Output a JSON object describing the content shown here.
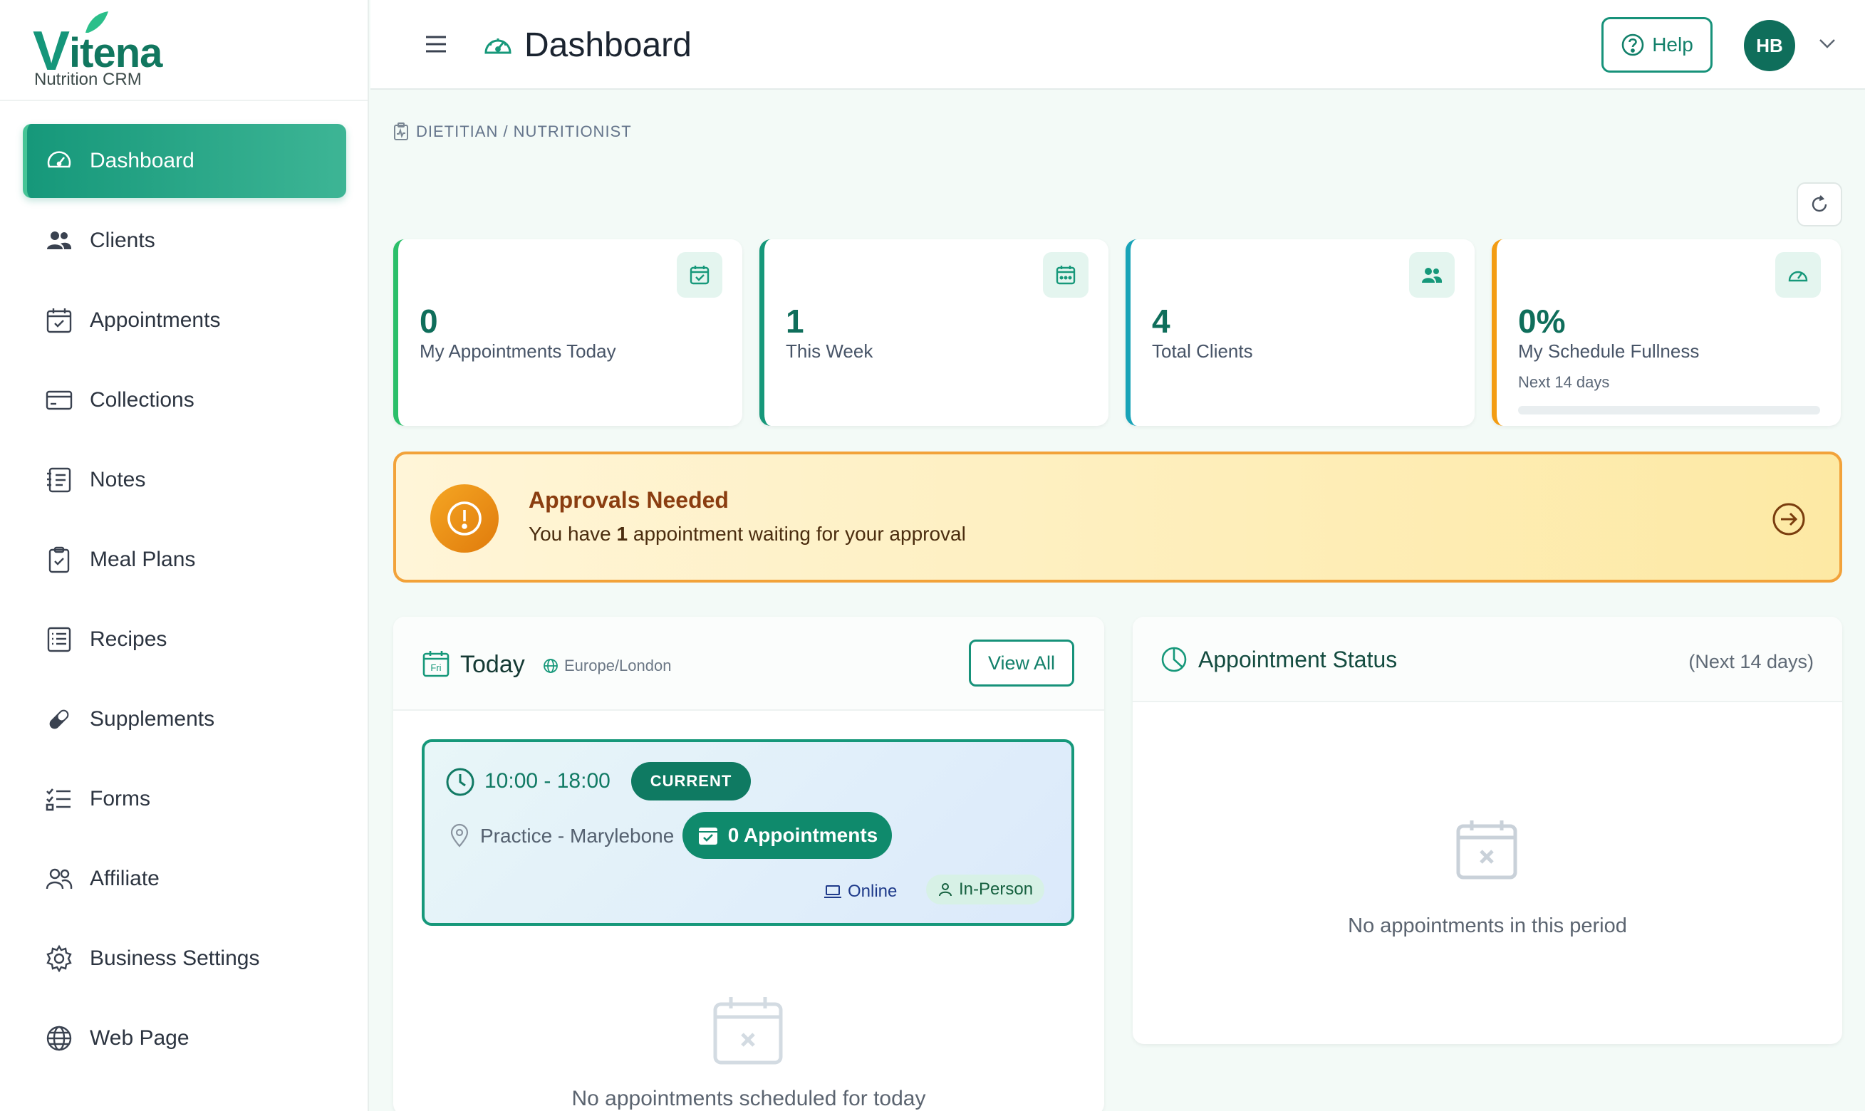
{
  "brand": {
    "name": "itena",
    "initial": "V",
    "subtitle": "Nutrition CRM"
  },
  "sidebar": {
    "items": [
      {
        "label": "Dashboard",
        "icon": "gauge-icon",
        "active": true
      },
      {
        "label": "Clients",
        "icon": "users-icon"
      },
      {
        "label": "Appointments",
        "icon": "calendar-check-icon"
      },
      {
        "label": "Collections",
        "icon": "credit-card-icon"
      },
      {
        "label": "Notes",
        "icon": "notes-icon"
      },
      {
        "label": "Meal Plans",
        "icon": "clipboard-check-icon"
      },
      {
        "label": "Recipes",
        "icon": "recipe-list-icon"
      },
      {
        "label": "Supplements",
        "icon": "capsule-icon"
      },
      {
        "label": "Forms",
        "icon": "checklist-icon"
      },
      {
        "label": "Affiliate",
        "icon": "people-outline-icon"
      },
      {
        "label": "Business Settings",
        "icon": "gear-icon"
      },
      {
        "label": "Web Page",
        "icon": "globe-icon"
      }
    ]
  },
  "header": {
    "title": "Dashboard",
    "help_label": "Help",
    "avatar_initials": "HB"
  },
  "breadcrumb": "DIETITIAN / NUTRITIONIST",
  "stats": [
    {
      "value": "0",
      "label": "My Appointments Today",
      "accent": "#2bbf6a",
      "icon": "calendar-check-icon"
    },
    {
      "value": "1",
      "label": "This Week",
      "accent": "#16987a",
      "icon": "calendar-week-icon"
    },
    {
      "value": "4",
      "label": "Total Clients",
      "accent": "#18a3b8",
      "icon": "users-icon"
    },
    {
      "value": "0%",
      "label": "My Schedule Fullness",
      "sub": "Next 14 days",
      "accent": "#f39c12",
      "icon": "gauge-icon",
      "progress": 0
    }
  ],
  "approvals": {
    "title": "Approvals Needed",
    "text_pre": "You have ",
    "count": "1",
    "text_post": " appointment waiting for your approval"
  },
  "today": {
    "title": "Today",
    "day_abbr": "Fri",
    "timezone": "Europe/London",
    "view_all": "View All",
    "slot": {
      "time": "10:00 - 18:00",
      "status": "CURRENT",
      "location": "Practice - Marylebone",
      "appointments": "0 Appointments",
      "online": "Online",
      "in_person": "In-Person"
    },
    "empty": "No appointments scheduled for today"
  },
  "appointment_status": {
    "title": "Appointment Status",
    "range": "(Next 14 days)",
    "empty": "No appointments in this period"
  },
  "colors": {
    "primary": "#16987a",
    "dark": "#0f6e5b",
    "warning": "#f39c12"
  }
}
